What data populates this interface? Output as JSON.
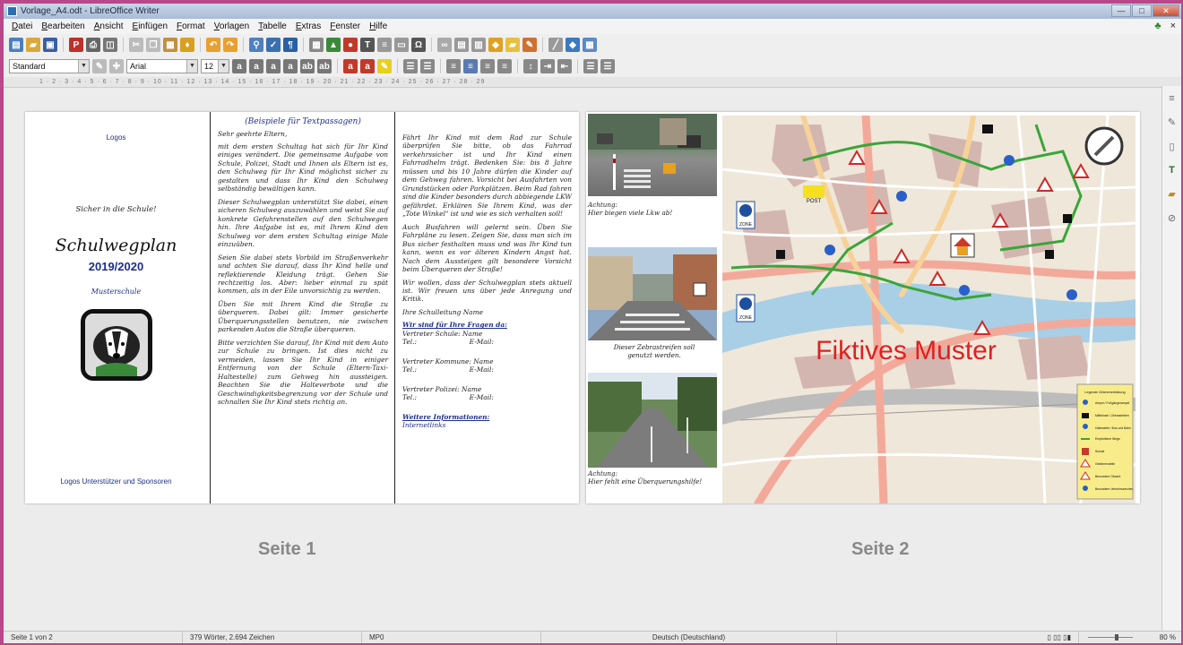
{
  "window": {
    "title": "Vorlage_A4.odt - LibreOffice Writer",
    "minimize": "—",
    "maximize": "□",
    "close": "✕"
  },
  "menu": [
    "Datei",
    "Bearbeiten",
    "Ansicht",
    "Einfügen",
    "Format",
    "Vorlagen",
    "Tabelle",
    "Extras",
    "Fenster",
    "Hilfe"
  ],
  "menu_close_label": "×",
  "formatting": {
    "style": "Standard",
    "font": "Arial",
    "size": "12"
  },
  "ruler_text": "1 · 2 · 3 · 4 · 5 · 6 · 7 · 8 · 9 · 10 · 11 · 12 · 13 · 14 · 15 · 16 · 17 · 18 · 19 · 20 · 21 · 22 · 23 · 24 · 25 · 26 · 27 · 28 · 29",
  "page1": {
    "label": "Seite 1",
    "logos": "Logos",
    "tagline": "Sicher in die Schule!",
    "title": "Schulwegplan",
    "year": "2019/2020",
    "school": "Musterschule",
    "sponsors": "Logos Unterstützer und Sponsoren",
    "col2_heading": "(Beispiele für Textpassagen)",
    "salutation": "Sehr geehrte Eltern,",
    "p1": "mit dem ersten Schultag hat sich für Ihr Kind einiges verändert. Die gemeinsame Aufgabe von Schule, Polizei, Stadt und Ihnen als Eltern ist es, den Schulweg für Ihr Kind möglichst sicher zu gestalten und dass Ihr Kind den Schulweg selbständig bewältigen kann.",
    "p2": "Dieser Schulwegplan unterstützt Sie dabei, einen sicheren Schulweg auszuwählen und weist Sie auf konkrete Gefahrenstellen auf den Schulwegen hin. Ihre Aufgabe ist es, mit Ihrem Kind den Schulweg vor dem ersten Schultag einige Male einzuüben.",
    "p3": "Seien Sie dabei stets Vorbild im Straßenverkehr und achten Sie darauf, dass Ihr Kind helle und reflektierende Kleidung trägt. Gehen Sie rechtzeitig los. Aber: lieber einmal zu spät kommen, als in der Eile unvorsichtig zu werden.",
    "p4": "Üben Sie mit Ihrem Kind die Straße zu überqueren. Dabei gilt: Immer gesicherte Überquerungsstellen benutzen, nie zwischen parkenden Autos die Straße überqueren.",
    "p5": "Bitte verzichten Sie darauf, Ihr Kind mit dem Auto zur Schule zu bringen. Ist dies nicht zu vermeiden, lassen Sie Ihr Kind in einiger Entfernung von der Schule (Eltern-Taxi-Haltestelle) zum Gehweg hin aussteigen. Beachten Sie die Halteverbote und die Geschwindigkeitsbegrenzung vor der Schule und schnallen Sie Ihr Kind stets richtig an.",
    "p6": "Fährt Ihr Kind mit dem Rad zur Schule überprüfen Sie bitte, ob das Fahrrad verkehrssicher ist und Ihr Kind einen Fahrradhelm trägt. Bedenken Sie: bis 8 Jahre müssen und bis 10 Jahre dürfen die Kinder auf dem Gehweg fahren. Vorsicht bei Ausfahrten von Grundstücken oder Parkplätzen. Beim Rad fahren sind die Kinder besonders durch abbiegende LKW gefährdet. Erklären Sie Ihrem Kind, was der „Tote Winkel\" ist und wie es sich verhalten soll!",
    "p7": "Auch Busfahren will gelernt sein. Üben Sie Fahrpläne zu lesen. Zeigen Sie, dass man sich im Bus sicher festhalten muss und was Ihr Kind tun kann, wenn es vor älteren Kindern Angst hat. Nach dem Aussteigen gilt besondere Vorsicht beim Überqueren der Straße!",
    "p8": "Wir wollen, dass der Schulwegplan stets aktuell ist. Wir freuen uns über jede Anregung und Kritik.",
    "closing": "Ihre Schulleitung Name",
    "contact_heading": "Wir sind für Ihre Fragen da:",
    "contact1a": "Vertreter Schule: Name",
    "contact1b": "Tel.:                         E-Mail:",
    "contact2a": "Vertreter Kommune: Name",
    "contact2b": "Tel.:                         E-Mail:",
    "contact3a": "Vertreter Polizei: Name",
    "contact3b": "Tel.:                         E-Mail:",
    "more_heading": "Weitere Informationen:",
    "more_links": "Internetlinks"
  },
  "page2": {
    "label": "Seite 2",
    "caption1": "Achtung:\nHier biegen viele Lkw ab!",
    "caption2": "Dieser Zebrastreifen soll genutzt werden.",
    "caption3": "Achtung:\nHier fehlt eine Überquerungshilfe!",
    "watermark": "Fiktives Muster",
    "post": "POST",
    "zone": "ZONE",
    "legend": [
      "Legende Zeichenerklärung",
      "Ampel / Fußgängerampel",
      "Mittelinsel / Zebrastreifen",
      "Haltestelle / Bus und Bahn",
      "Empfohlene Wege",
      "Schule",
      "Gefahrenstelle",
      "Besondere Obacht",
      "Besondere Verkehrszeichen"
    ]
  },
  "status": {
    "page": "Seite 1 von 2",
    "words": "379 Wörter, 2.694 Zeichen",
    "style": "MP0",
    "lang": "Deutsch (Deutschland)",
    "zoom": "80 %"
  }
}
